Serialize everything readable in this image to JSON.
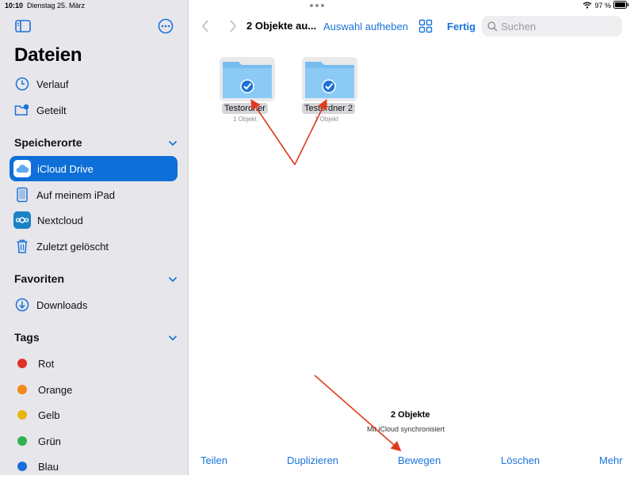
{
  "status_bar": {
    "time": "10:10",
    "date": "Dienstag 25. März",
    "battery": "97 %"
  },
  "sidebar": {
    "title": "Dateien",
    "top_items": [
      {
        "label": "Verlauf",
        "icon": "clock-icon"
      },
      {
        "label": "Geteilt",
        "icon": "shared-folder-icon"
      }
    ],
    "locations_heading": "Speicherorte",
    "locations": [
      {
        "label": "iCloud Drive",
        "icon": "icloud-icon",
        "selected": true
      },
      {
        "label": "Auf meinem iPad",
        "icon": "ipad-icon"
      },
      {
        "label": "Nextcloud",
        "icon": "nextcloud-icon"
      },
      {
        "label": "Zuletzt gelöscht",
        "icon": "trash-icon"
      }
    ],
    "favorites_heading": "Favoriten",
    "favorites": [
      {
        "label": "Downloads",
        "icon": "download-icon"
      }
    ],
    "tags_heading": "Tags",
    "tags": [
      {
        "label": "Rot",
        "color": "#e0302a"
      },
      {
        "label": "Orange",
        "color": "#f08a1c"
      },
      {
        "label": "Gelb",
        "color": "#e6b80e"
      },
      {
        "label": "Grün",
        "color": "#2fb34c"
      },
      {
        "label": "Blau",
        "color": "#1a6fdc"
      }
    ]
  },
  "toolbar": {
    "title": "2 Objekte au...",
    "deselect_label": "Auswahl aufheben",
    "done_label": "Fertig",
    "search_placeholder": "Suchen"
  },
  "folders": [
    {
      "name": "Testordner",
      "count": "1 Objekt",
      "selected": true
    },
    {
      "name": "Testordner 2",
      "count": "1 Objekt",
      "selected": true
    }
  ],
  "footer": {
    "count": "2 Objekte",
    "sync": "Mit iCloud synchronisiert"
  },
  "actions": {
    "share": "Teilen",
    "duplicate": "Duplizieren",
    "move": "Bewegen",
    "delete": "Löschen",
    "more": "Mehr"
  },
  "colors": {
    "accent": "#1a73d9",
    "selection": "#0f6fd8",
    "annotation_arrow": "#e03a1e"
  }
}
